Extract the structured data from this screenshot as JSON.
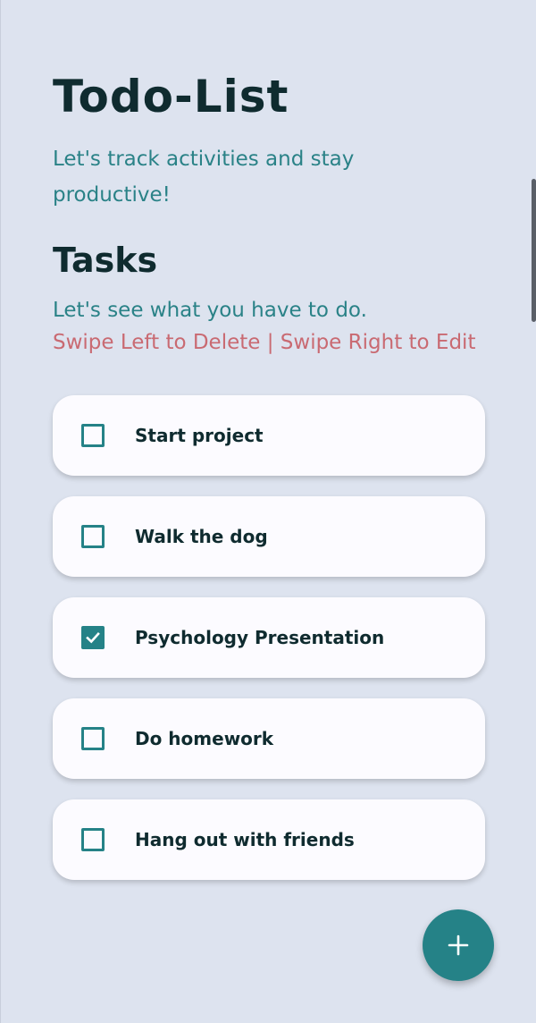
{
  "header": {
    "title": "Todo-List",
    "subtitle": "Let's track activities and stay productive!"
  },
  "tasks_section": {
    "title": "Tasks",
    "subtitle": "Let's see what you have to do.",
    "hint": "Swipe Left to Delete | Swipe Right to Edit"
  },
  "tasks": [
    {
      "label": "Start project",
      "checked": false
    },
    {
      "label": "Walk the dog",
      "checked": false
    },
    {
      "label": "Psychology Presentation",
      "checked": true
    },
    {
      "label": "Do homework",
      "checked": false
    },
    {
      "label": "Hang out with friends",
      "checked": false
    }
  ],
  "fab": {
    "icon": "plus-icon"
  },
  "colors": {
    "background": "#dde3ef",
    "accent": "#258287",
    "title_text": "#0f2b2f",
    "subtitle_text": "#2a8287",
    "hint_text": "#c96a72",
    "card": "#fcfbff"
  }
}
